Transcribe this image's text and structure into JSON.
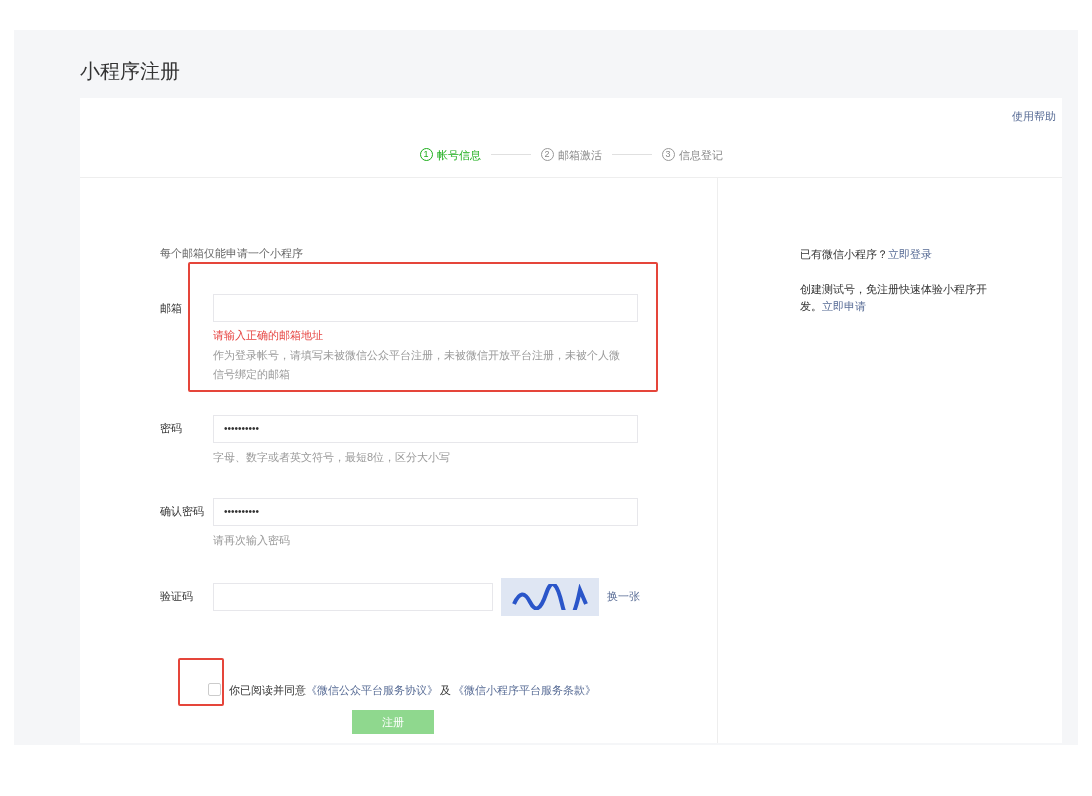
{
  "page": {
    "title": "小程序注册",
    "help_link": "使用帮助"
  },
  "steps": [
    {
      "number": "1",
      "label": "帐号信息",
      "selected": true
    },
    {
      "number": "2",
      "label": "邮箱激活",
      "selected": false
    },
    {
      "number": "3",
      "label": "信息登记",
      "selected": false
    }
  ],
  "form": {
    "note": "每个邮箱仅能申请一个小程序",
    "fields": [
      {
        "label": "邮箱",
        "error": "请输入正确的邮箱地址",
        "hint": "作为登录帐号，请填写未被微信公众平台注册，未被微信开放平台注册，未被个人微信号绑定的邮箱",
        "highlighted": true
      },
      {
        "label": "密码",
        "value": "••••••••••",
        "hint": "字母、数字或者英文符号，最短8位，区分大小写",
        "highlighted": false
      },
      {
        "label": "确认密码",
        "value": "••••••••••",
        "hint": "请再次输入密码",
        "highlighted": false
      }
    ],
    "captcha": {
      "label": "验证码",
      "refresh_link": "换一张"
    },
    "agreement": {
      "checked": false,
      "highlighted": true,
      "text": "你已阅读并同意",
      "link_1": "《微信公众平台服务协议》",
      "joiner": "及",
      "link_2": "《微信小程序平台服务条款》"
    },
    "submit": {
      "label": "注册",
      "disabled": true
    }
  },
  "sidebar": {
    "login_text": "已有微信小程序？",
    "login_link": "立即登录",
    "test_text": "创建测试号，免注册快速体验小程序开发。",
    "test_link": "立即申请"
  }
}
